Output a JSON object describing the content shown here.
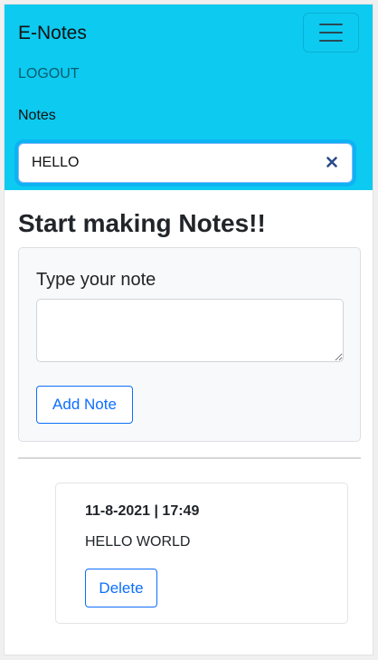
{
  "navbar": {
    "brand": "E-Notes",
    "links": {
      "logout": "LOGOUT",
      "notes": "Notes"
    },
    "search": {
      "value": "HELLO",
      "placeholder": ""
    }
  },
  "main": {
    "heading": "Start making Notes!!",
    "form": {
      "label": "Type your note",
      "textarea_value": "",
      "add_button": "Add Note"
    },
    "notes": [
      {
        "date": "11-8-2021 | 17:49",
        "text": "HELLO WORLD",
        "delete_label": "Delete"
      }
    ]
  },
  "colors": {
    "navbar_bg": "#0dcaf0",
    "primary": "#0d6efd"
  },
  "icons": {
    "menu": "hamburger-menu-icon",
    "clear": "close-icon"
  }
}
